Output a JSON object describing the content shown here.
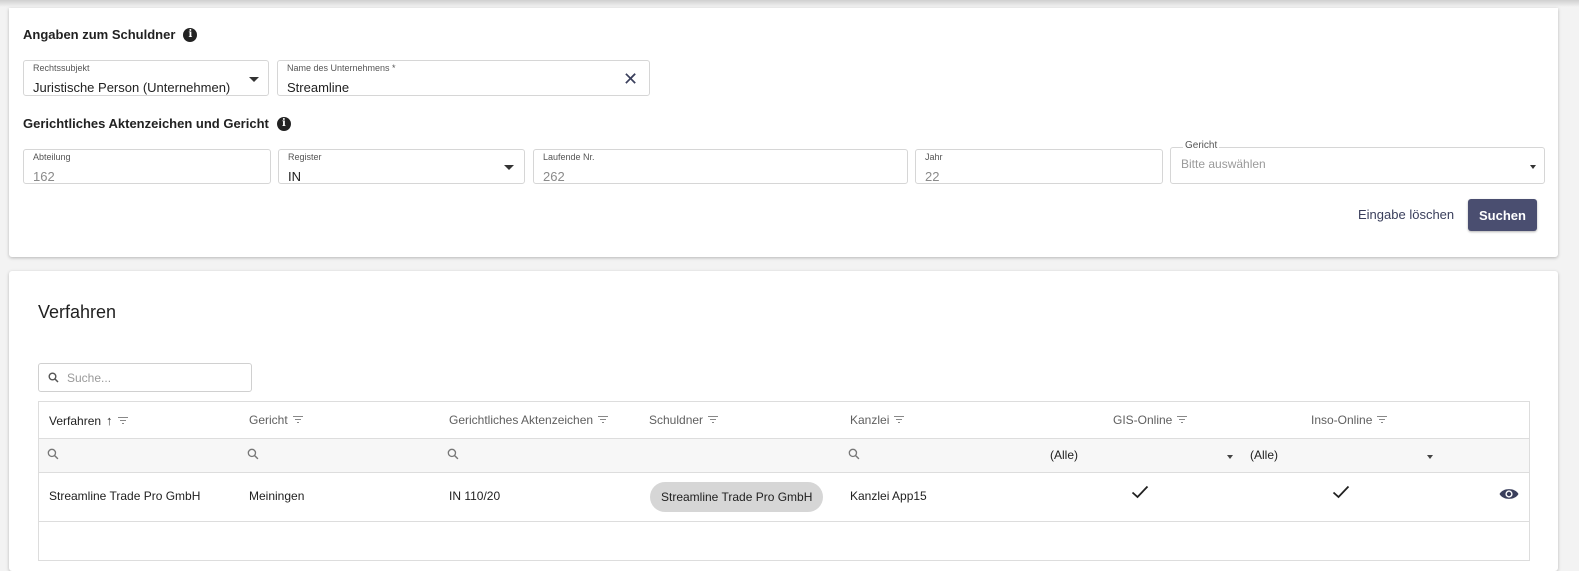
{
  "schuldner": {
    "title": "Angaben zum Schuldner",
    "rechtssubjekt": {
      "label": "Rechtssubjekt",
      "value": "Juristische Person (Unternehmen)"
    },
    "unternehmen": {
      "label": "Name des Unternehmens *",
      "value": "Streamline"
    }
  },
  "aktenzeichen": {
    "title": "Gerichtliches Aktenzeichen und Gericht",
    "abteilung": {
      "label": "Abteilung",
      "value": "162"
    },
    "register": {
      "label": "Register",
      "value": "IN"
    },
    "laufende_nr": {
      "label": "Laufende Nr.",
      "value": "262"
    },
    "jahr": {
      "label": "Jahr",
      "value": "22"
    },
    "gericht": {
      "label": "Gericht",
      "placeholder": "Bitte auswählen"
    }
  },
  "actions": {
    "clear_label": "Eingabe löschen",
    "search_label": "Suchen"
  },
  "verfahren": {
    "title": "Verfahren",
    "search_placeholder": "Suche...",
    "columns": [
      "Verfahren",
      "Gericht",
      "Gerichtliches Aktenzeichen",
      "Schuldner",
      "Kanzlei",
      "GIS-Online",
      "Inso-Online"
    ],
    "sort_column": "Verfahren",
    "filters": {
      "gis_online": "(Alle)",
      "inso_online": "(Alle)"
    },
    "rows": [
      {
        "verfahren": "Streamline Trade Pro GmbH",
        "gericht": "Meiningen",
        "aktenzeichen": "IN 110/20",
        "schuldner": "Streamline Trade Pro GmbH",
        "kanzlei": "Kanzlei App15",
        "gis_online": true,
        "inso_online": true
      }
    ]
  },
  "colors": {
    "primary": "#4a4e70",
    "chip": "#d6d6d6"
  },
  "icons": [
    "info-icon",
    "chevron-down-icon",
    "close-icon",
    "search-icon",
    "filter-icon",
    "sort-up-icon",
    "check-icon",
    "eye-icon"
  ]
}
